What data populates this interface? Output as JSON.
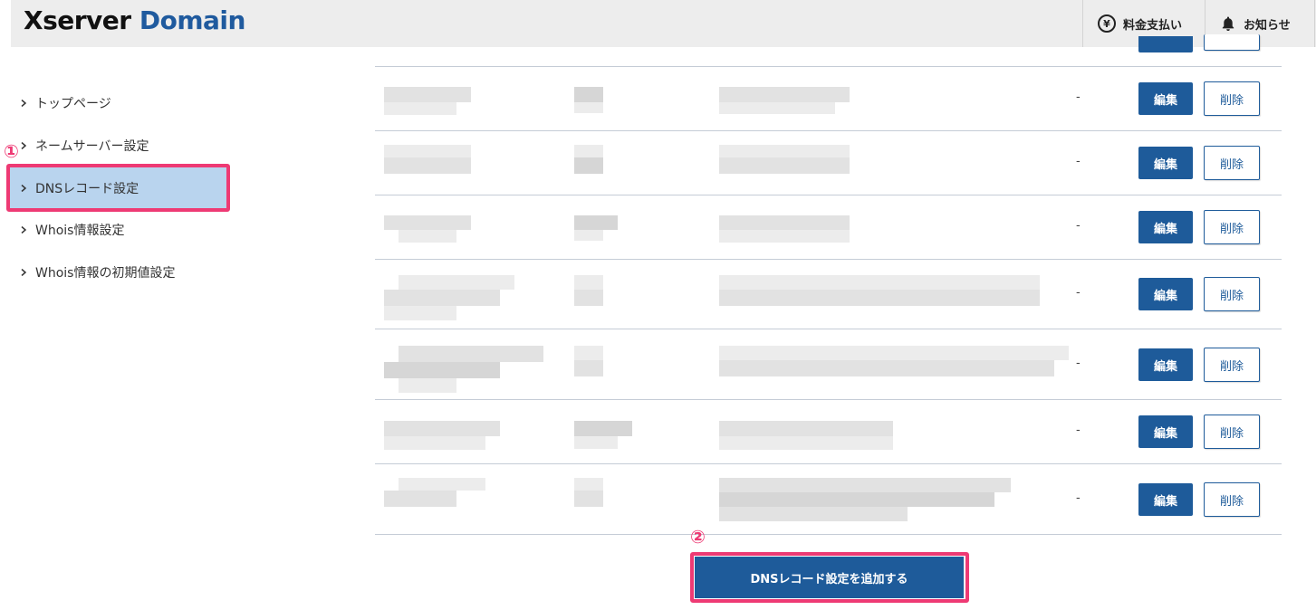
{
  "header": {
    "logo_primary": "Xserver",
    "logo_secondary": "Domain",
    "payment_label": "料金支払い",
    "payment_icon": "yen-icon",
    "notice_label": "お知らせ",
    "notice_icon": "bell-icon",
    "background_color": "#ededed",
    "brand_color": "#1f5a9e"
  },
  "sidebar": {
    "items": [
      {
        "label": "トップページ"
      },
      {
        "label": "ネームサーバー設定"
      },
      {
        "label": "DNSレコード設定",
        "active": true
      },
      {
        "label": "Whois情報設定"
      },
      {
        "label": "Whois情報の初期値設定"
      }
    ],
    "active_color": "#b9d4ee"
  },
  "annotations": {
    "step1": "①",
    "step2": "②",
    "highlight_color": "#ee3a74"
  },
  "records": {
    "rows": [
      {
        "value": "-",
        "edit_label": "編集",
        "delete_label": "削除"
      },
      {
        "value": "-",
        "edit_label": "編集",
        "delete_label": "削除"
      },
      {
        "value": "-",
        "edit_label": "編集",
        "delete_label": "削除"
      },
      {
        "value": "-",
        "edit_label": "編集",
        "delete_label": "削除"
      },
      {
        "value": "-",
        "edit_label": "編集",
        "delete_label": "削除"
      },
      {
        "value": "-",
        "edit_label": "編集",
        "delete_label": "削除"
      },
      {
        "value": "-",
        "edit_label": "編集",
        "delete_label": "削除"
      }
    ],
    "button_color": "#1e5b9a"
  },
  "add_button_label": "DNSレコード設定を追加する"
}
